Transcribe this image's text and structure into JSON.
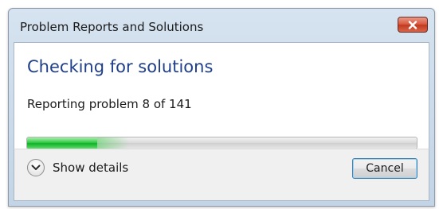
{
  "window": {
    "title": "Problem Reports and Solutions",
    "close_icon": "close-icon"
  },
  "main": {
    "heading": "Checking for solutions",
    "status": "Reporting problem 8 of 141",
    "progress_fraction": 0.18
  },
  "footer": {
    "details_label": "Show details",
    "details_icon": "chevron-down-icon",
    "cancel_label": "Cancel"
  },
  "colors": {
    "heading": "#1f3f8a",
    "progress": "#10b326",
    "close_button": "#c03a1f"
  }
}
